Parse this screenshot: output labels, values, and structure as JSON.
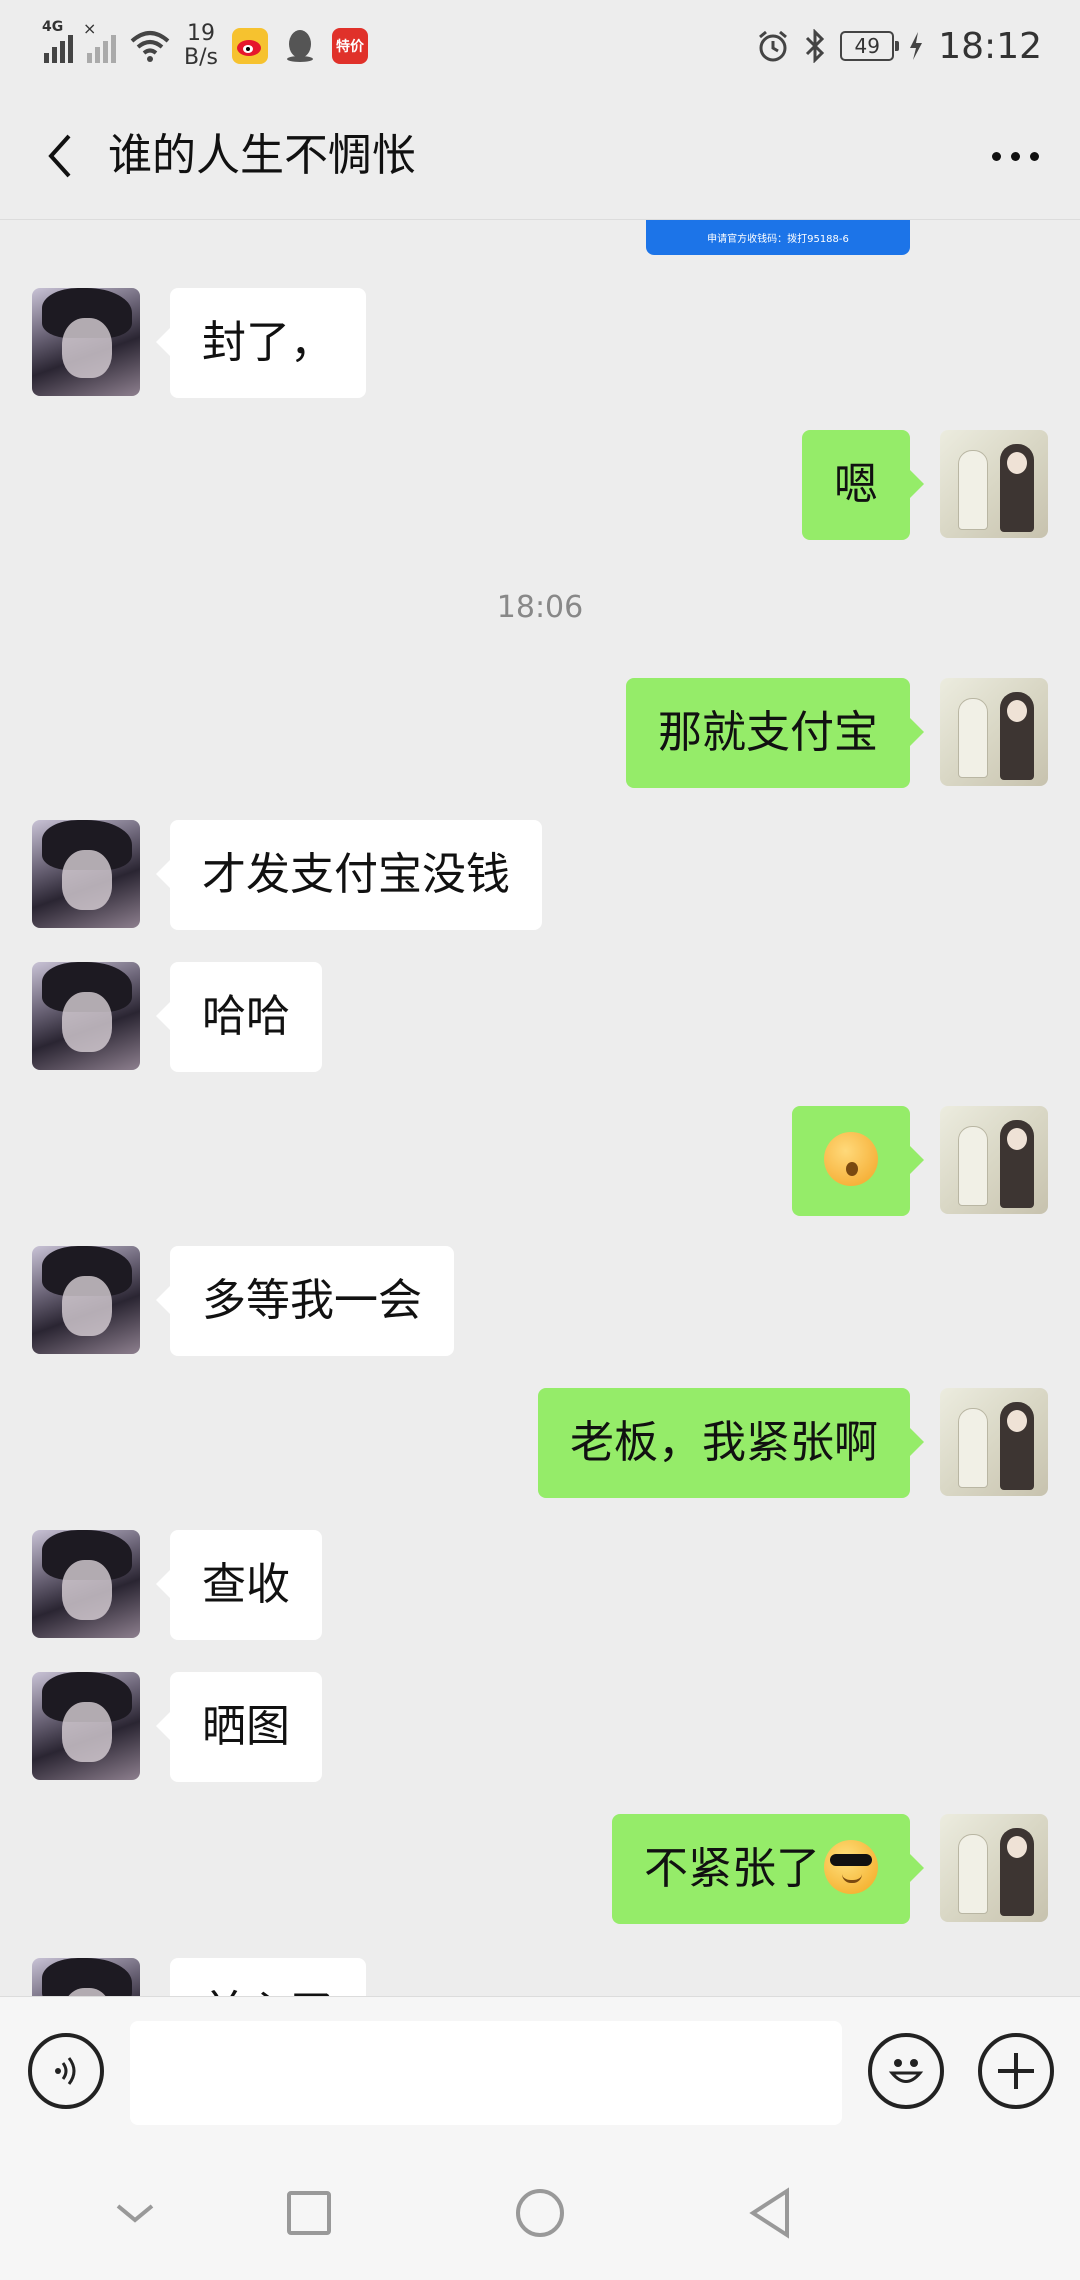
{
  "status_bar": {
    "network_tag": "4G",
    "speed_value": "19",
    "speed_unit": "B/s",
    "apps": [
      "weibo-icon",
      "qq-icon",
      "tejia-icon"
    ],
    "tejia_label": "特价",
    "battery": "49",
    "time": "18:12"
  },
  "header": {
    "title": "谁的人生不惆怅"
  },
  "chat": {
    "top_card_text": "申请官方收钱码：拨打95188-6",
    "messages": [
      {
        "side": "left",
        "text": "封了，"
      },
      {
        "side": "right",
        "text": "嗯"
      },
      {
        "side": "time",
        "text": "18:06"
      },
      {
        "side": "right",
        "text": "那就支付宝"
      },
      {
        "side": "left",
        "text": "才发支付宝没钱"
      },
      {
        "side": "left",
        "text": "哈哈"
      },
      {
        "side": "right",
        "text": "",
        "emoji": "kissing-face-emoji"
      },
      {
        "side": "left",
        "text": "多等我一会"
      },
      {
        "side": "right",
        "text": "老板，我紧张啊"
      },
      {
        "side": "left",
        "text": "查收"
      },
      {
        "side": "left",
        "text": "晒图"
      },
      {
        "side": "right",
        "text": "不紧张了",
        "emoji": "sunglasses-face-emoji"
      },
      {
        "side": "left",
        "text": "前心了"
      }
    ]
  },
  "input_bar": {
    "placeholder": ""
  },
  "colors": {
    "background": "#ededed",
    "sent_bubble": "#95ec69",
    "received_bubble": "#ffffff",
    "top_card": "#1c74e8"
  }
}
